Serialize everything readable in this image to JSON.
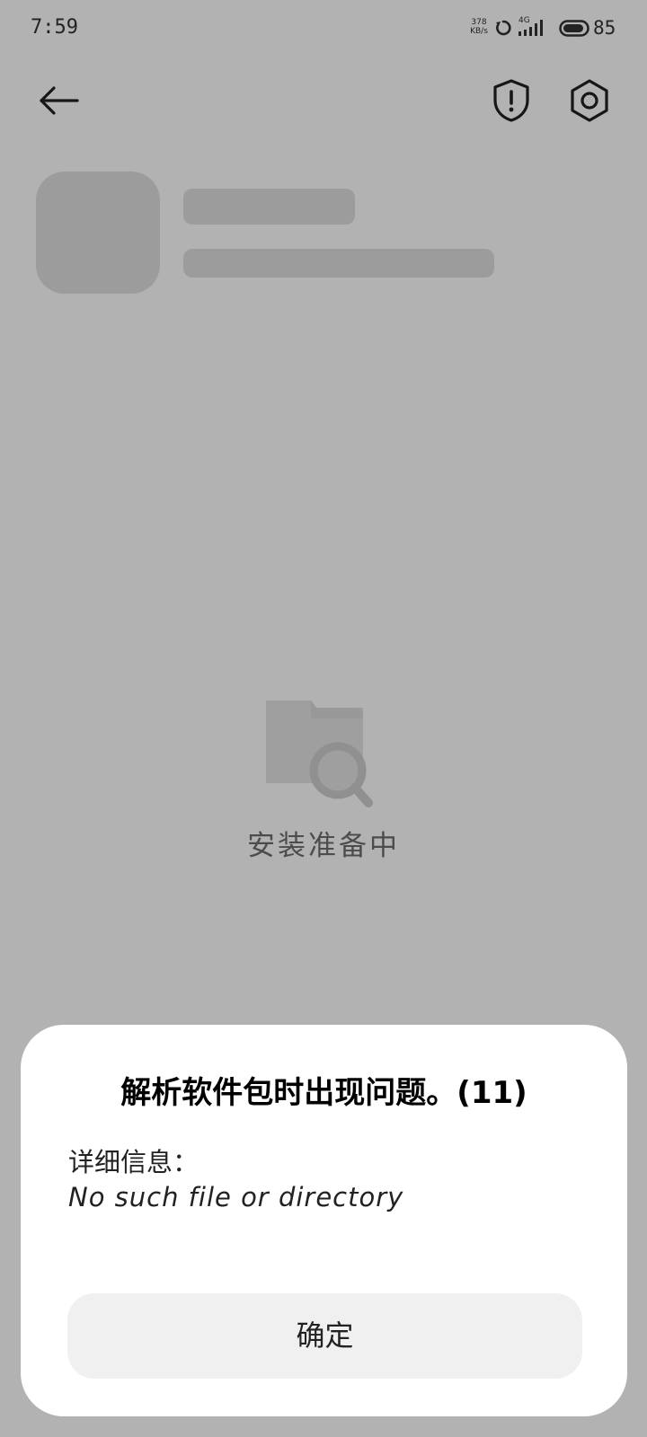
{
  "status_bar": {
    "time": "7:59",
    "net_speed_value": "378",
    "net_speed_unit": "KB/s",
    "network_type": "4G",
    "battery_level": "85"
  },
  "toolbar": {
    "back_icon": "arrow-left-icon",
    "shield_icon": "shield-alert-icon",
    "settings_icon": "gear-icon"
  },
  "main": {
    "loading_text": "安装准备中",
    "loading_icon": "folder-search-icon"
  },
  "dialog": {
    "title": "解析软件包时出现问题。(11)",
    "detail_label": "详细信息：",
    "detail_message": "No such file or directory",
    "confirm_label": "确定"
  },
  "colors": {
    "background": "#ffffff",
    "placeholder": "#e0e0e0",
    "overlay": "rgba(0,0,0,0.3)",
    "dialog_bg": "#ffffff",
    "button_bg": "#f0f0f0"
  }
}
